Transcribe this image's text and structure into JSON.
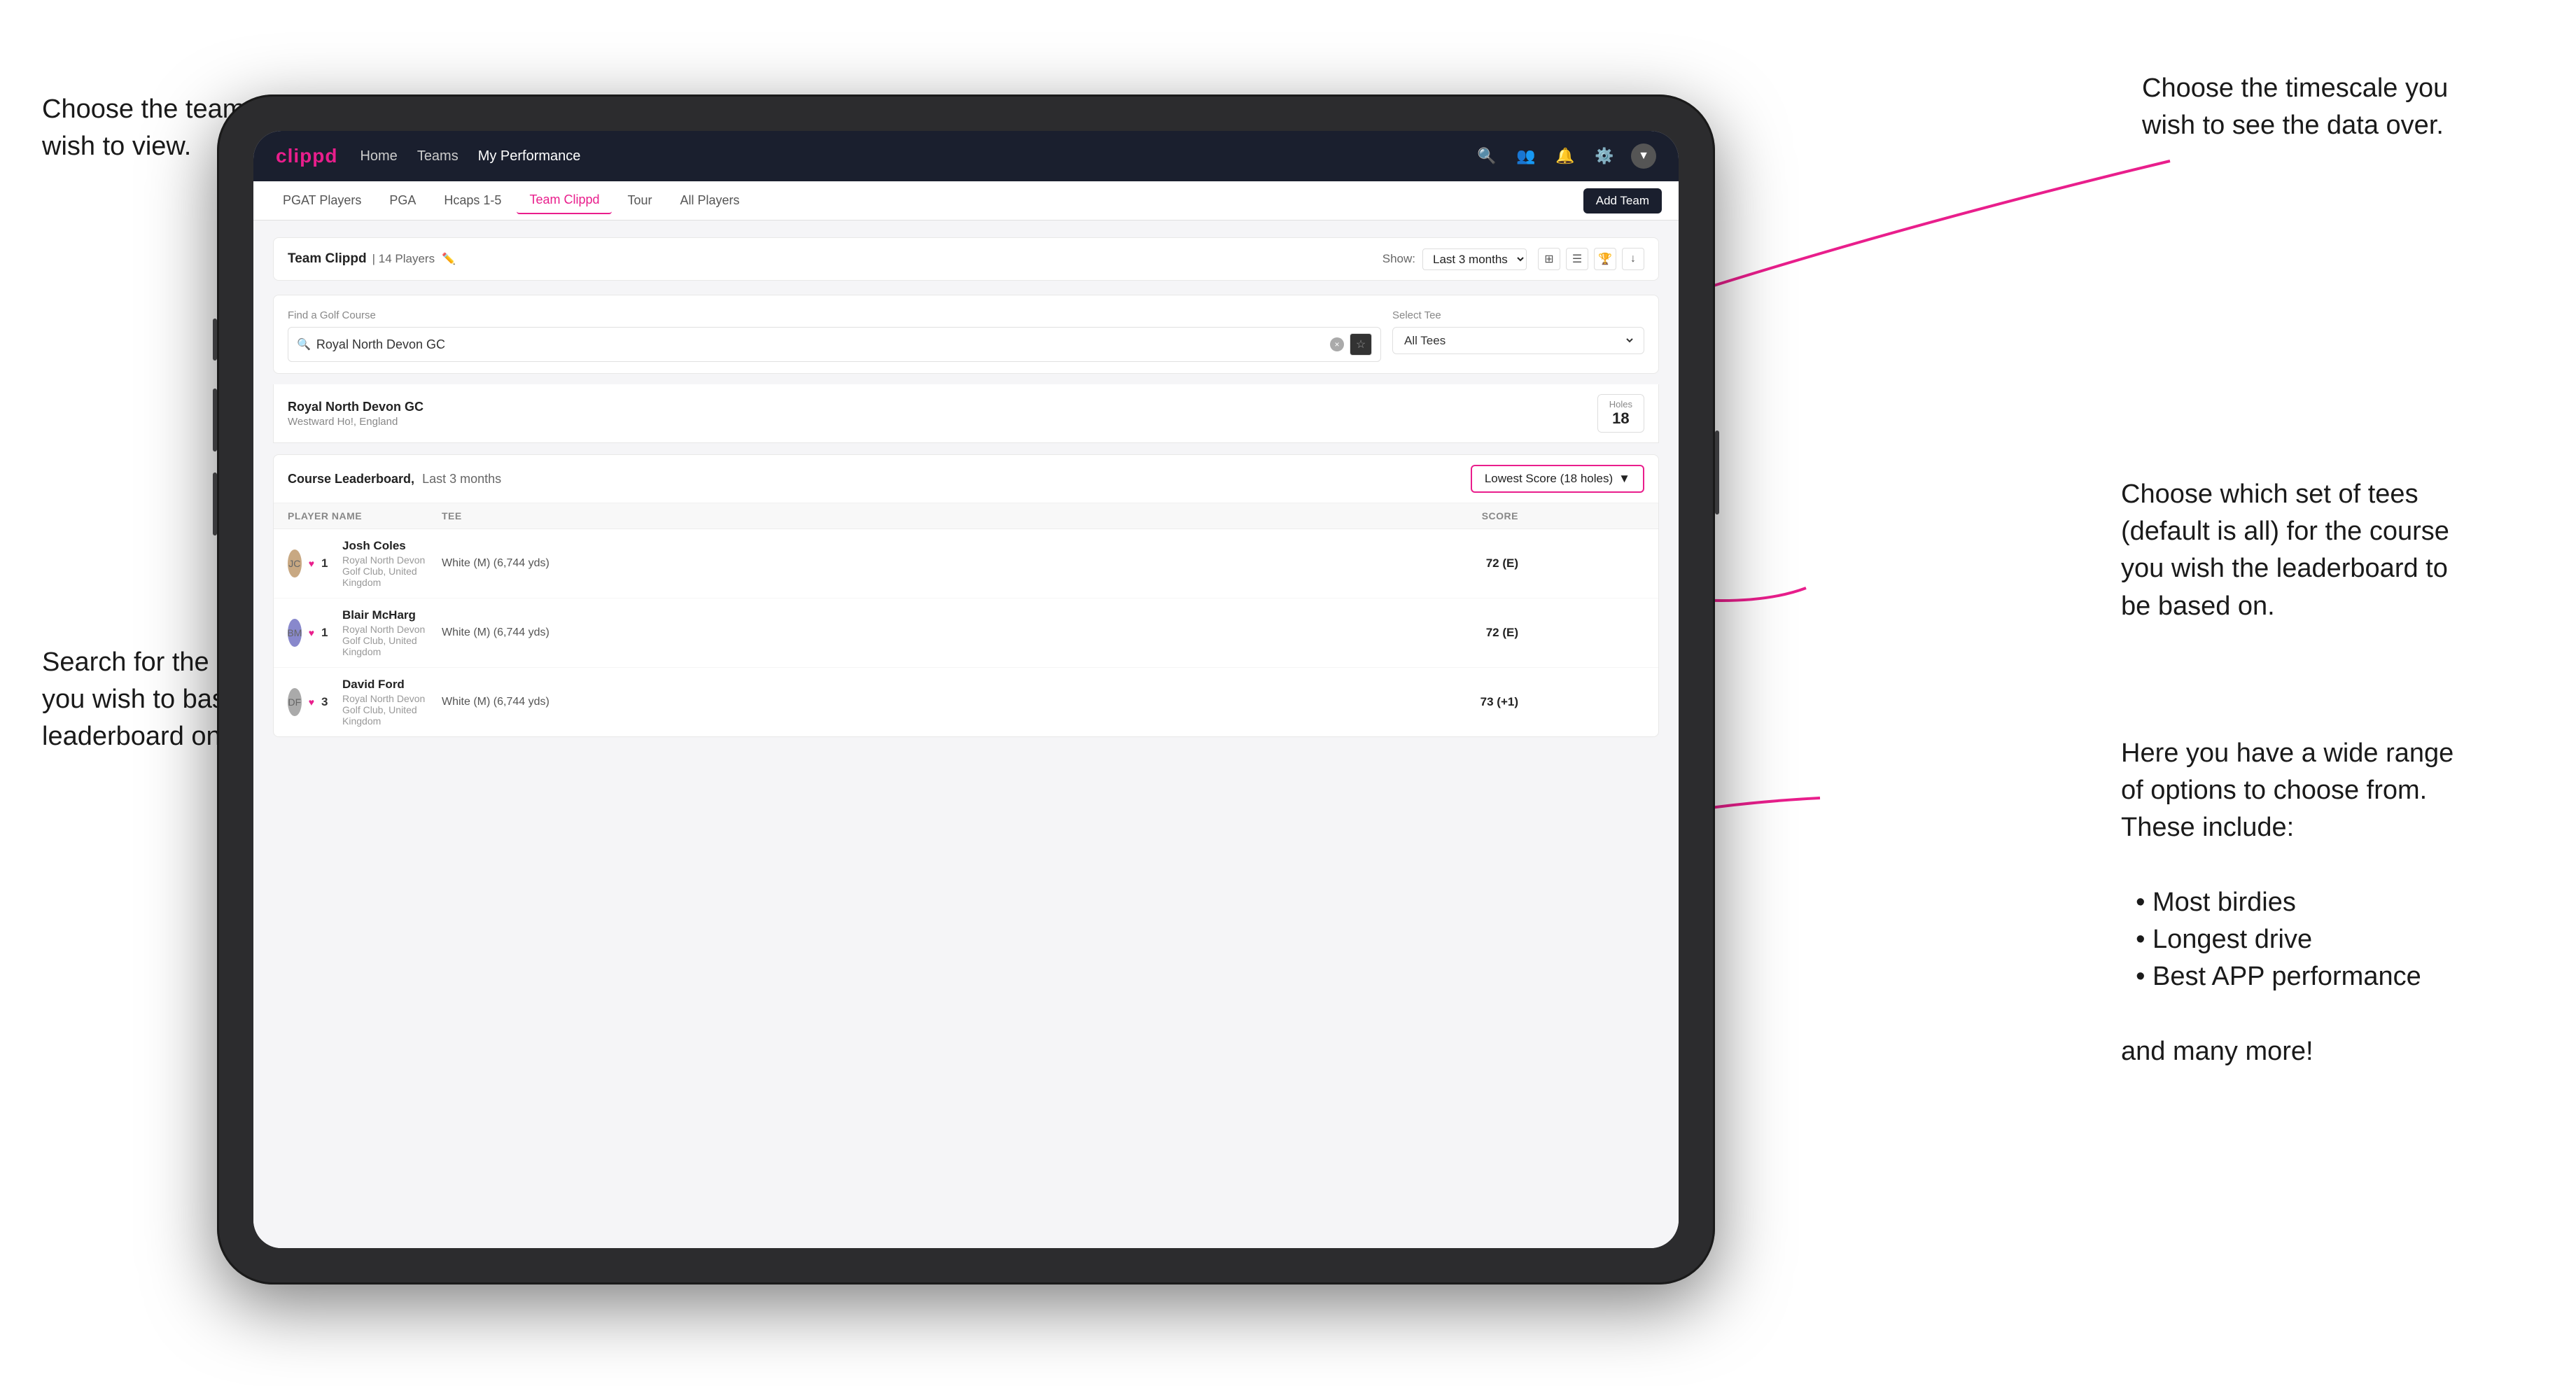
{
  "annotations": {
    "top_left": {
      "line1": "Choose the team you",
      "line2": "wish to view."
    },
    "bottom_left": {
      "line1": "Search for the course",
      "line2": "you wish to base the",
      "line3": "leaderboard on."
    },
    "top_right": {
      "line1": "Choose the timescale you",
      "line2": "wish to see the data over."
    },
    "middle_right": {
      "line1": "Choose which set of tees",
      "line2": "(default is all) for the course",
      "line3": "you wish the leaderboard to",
      "line4": "be based on."
    },
    "bottom_right": {
      "intro": "Here you have a wide range",
      "intro2": "of options to choose from.",
      "intro3": "These include:",
      "bullet1": "Most birdies",
      "bullet2": "Longest drive",
      "bullet3": "Best APP performance",
      "extra": "and many more!"
    }
  },
  "navbar": {
    "brand": "clippd",
    "links": [
      "Home",
      "Teams",
      "My Performance"
    ],
    "active_link": "My Performance"
  },
  "subnav": {
    "tabs": [
      "PGAT Players",
      "PGA",
      "Hcaps 1-5",
      "Team Clippd",
      "Tour",
      "All Players"
    ],
    "active_tab": "Team Clippd",
    "add_team_label": "Add Team"
  },
  "team_header": {
    "title": "Team Clippd",
    "count": "| 14 Players",
    "show_label": "Show:",
    "show_value": "Last 3 months"
  },
  "search_section": {
    "course_label": "Find a Golf Course",
    "course_value": "Royal North Devon GC",
    "tee_label": "Select Tee",
    "tee_value": "All Tees"
  },
  "course_result": {
    "name": "Royal North Devon GC",
    "location": "Westward Ho!, England",
    "holes_label": "Holes",
    "holes_value": "18"
  },
  "leaderboard": {
    "title": "Course Leaderboard,",
    "subtitle": "Last 3 months",
    "score_type": "Lowest Score (18 holes)",
    "columns": [
      "PLAYER NAME",
      "TEE",
      "SCORE"
    ],
    "players": [
      {
        "rank": "1",
        "name": "Josh Coles",
        "club": "Royal North Devon Golf Club, United Kingdom",
        "tee": "White (M) (6,744 yds)",
        "score": "72 (E)"
      },
      {
        "rank": "1",
        "name": "Blair McHarg",
        "club": "Royal North Devon Golf Club, United Kingdom",
        "tee": "White (M) (6,744 yds)",
        "score": "72 (E)"
      },
      {
        "rank": "3",
        "name": "David Ford",
        "club": "Royal North Devon Golf Club, United Kingdom",
        "tee": "White (M) (6,744 yds)",
        "score": "73 (+1)"
      }
    ]
  }
}
